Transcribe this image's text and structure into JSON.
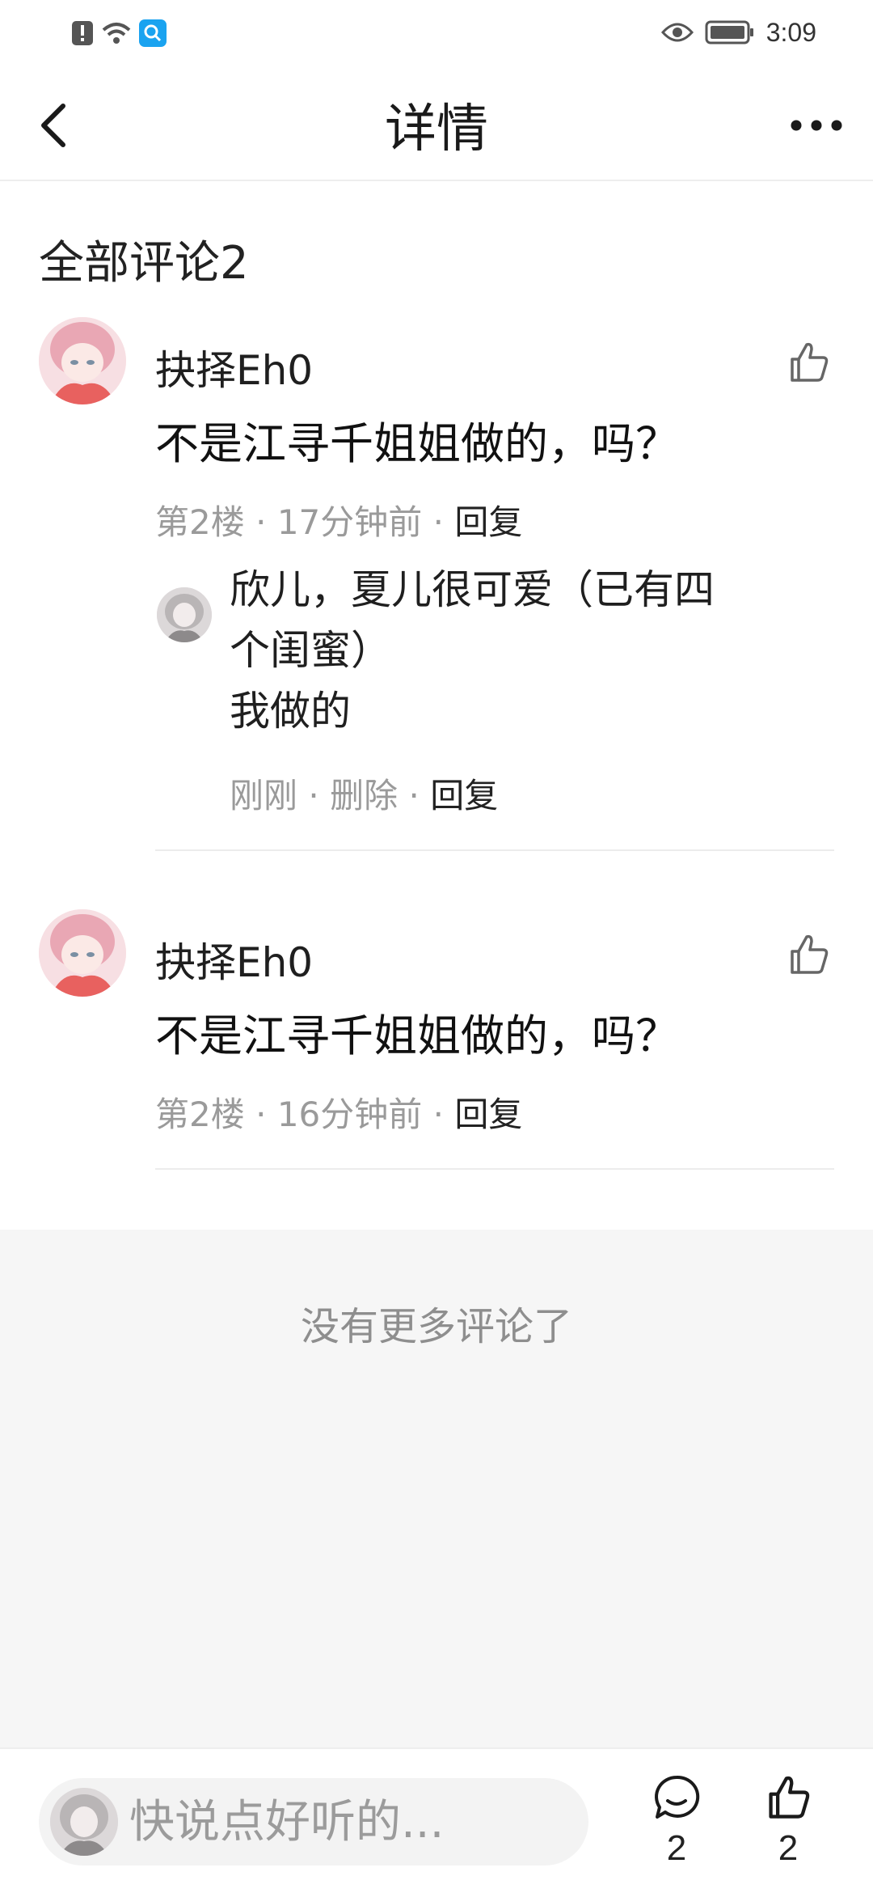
{
  "status_bar": {
    "time": "3:09",
    "icons": [
      "notification-alert-icon",
      "wifi-icon",
      "search-app-icon",
      "eye-icon",
      "battery-icon"
    ]
  },
  "header": {
    "title": "详情",
    "back_icon": "chevron-left-icon",
    "more_icon": "more-dots-icon"
  },
  "section": {
    "title": "全部评论2"
  },
  "comments": [
    {
      "user": "抉择Eh0",
      "text": "不是江寻千姐姐做的，吗？",
      "floor": "第2楼",
      "time": "17分钟前",
      "reply_label": "回复",
      "sep": "·",
      "reply": {
        "text_line1": "欣儿，夏儿很可爱（已有四",
        "text_line2": "个闺蜜）",
        "text_line3": "我做的",
        "time": "刚刚",
        "delete_label": "删除",
        "reply_label": "回复"
      }
    },
    {
      "user": "抉择Eh0",
      "text": "不是江寻千姐姐做的，吗？",
      "floor": "第2楼",
      "time": "16分钟前",
      "reply_label": "回复",
      "sep": "·"
    }
  ],
  "no_more": "没有更多评论了",
  "bottom_bar": {
    "placeholder": "快说点好听的...",
    "comment_count": "2",
    "like_count": "2"
  },
  "colors": {
    "text_primary": "#1f1f1f",
    "text_secondary": "#9a9a9a",
    "divider": "#ececec",
    "area_bg": "#f6f6f6",
    "accent_search": "#1aa3f0"
  }
}
